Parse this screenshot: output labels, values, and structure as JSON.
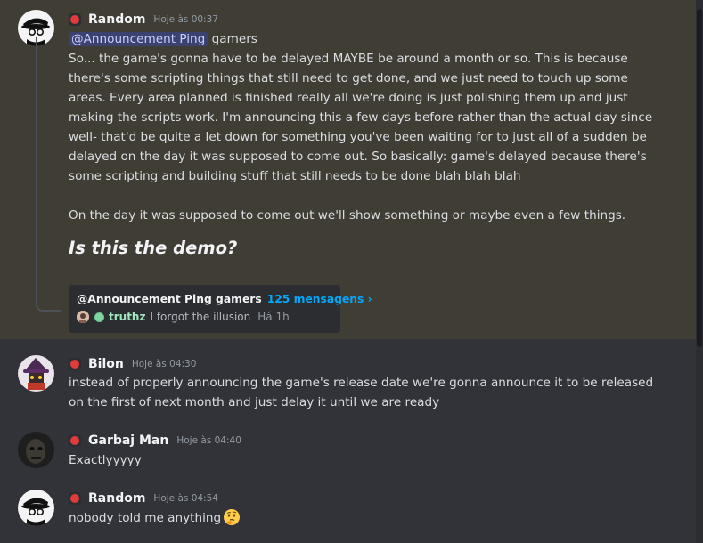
{
  "messages": {
    "m1": {
      "username": "Random",
      "timestamp": "Hoje às 00:37",
      "mention": "@Announcement Ping",
      "mention_after": " gamers",
      "paragraph1": "So... the game's gonna have to be delayed MAYBE be around a month or so. This is because there's some scripting things that still need to get done, and we just need to touch up some areas. Every area planned is finished really all we're doing is just polishing them up and just making the scripts work. I'm announcing this a few days before rather than the actual day since well- that'd be quite a let down for something you've been waiting for to just all of a sudden be delayed on the day it was supposed to come out. So basically: game's delayed because there's some scripting and building stuff that still needs to be done blah blah blah",
      "paragraph2": "On the day it was supposed to come out we'll show something or maybe even a few things.",
      "heading": "Is this the demo?",
      "thread": {
        "title": "@Announcement Ping gamers",
        "count": "125 mensagens ›",
        "last_user": "truthz",
        "last_text": "I forgot the illusion",
        "last_time": "Há 1h"
      }
    },
    "m2": {
      "username": "Bilon",
      "timestamp": "Hoje às 04:30",
      "text": "instead of properly announcing the game's release date we're gonna announce it to be released on the first of next month and just delay it until we are ready"
    },
    "m3": {
      "username": "Garbaj Man",
      "timestamp": "Hoje às 04:40",
      "text": "Exactlyyyyy"
    },
    "m4": {
      "username": "Random",
      "timestamp": "Hoje às 04:54",
      "text": "nobody told me anything",
      "emoji": "thinking-face"
    }
  },
  "colors": {
    "background": "#313338",
    "highlight": "#403d35",
    "role_dot": "#e03c3c",
    "link": "#00a8fc"
  }
}
